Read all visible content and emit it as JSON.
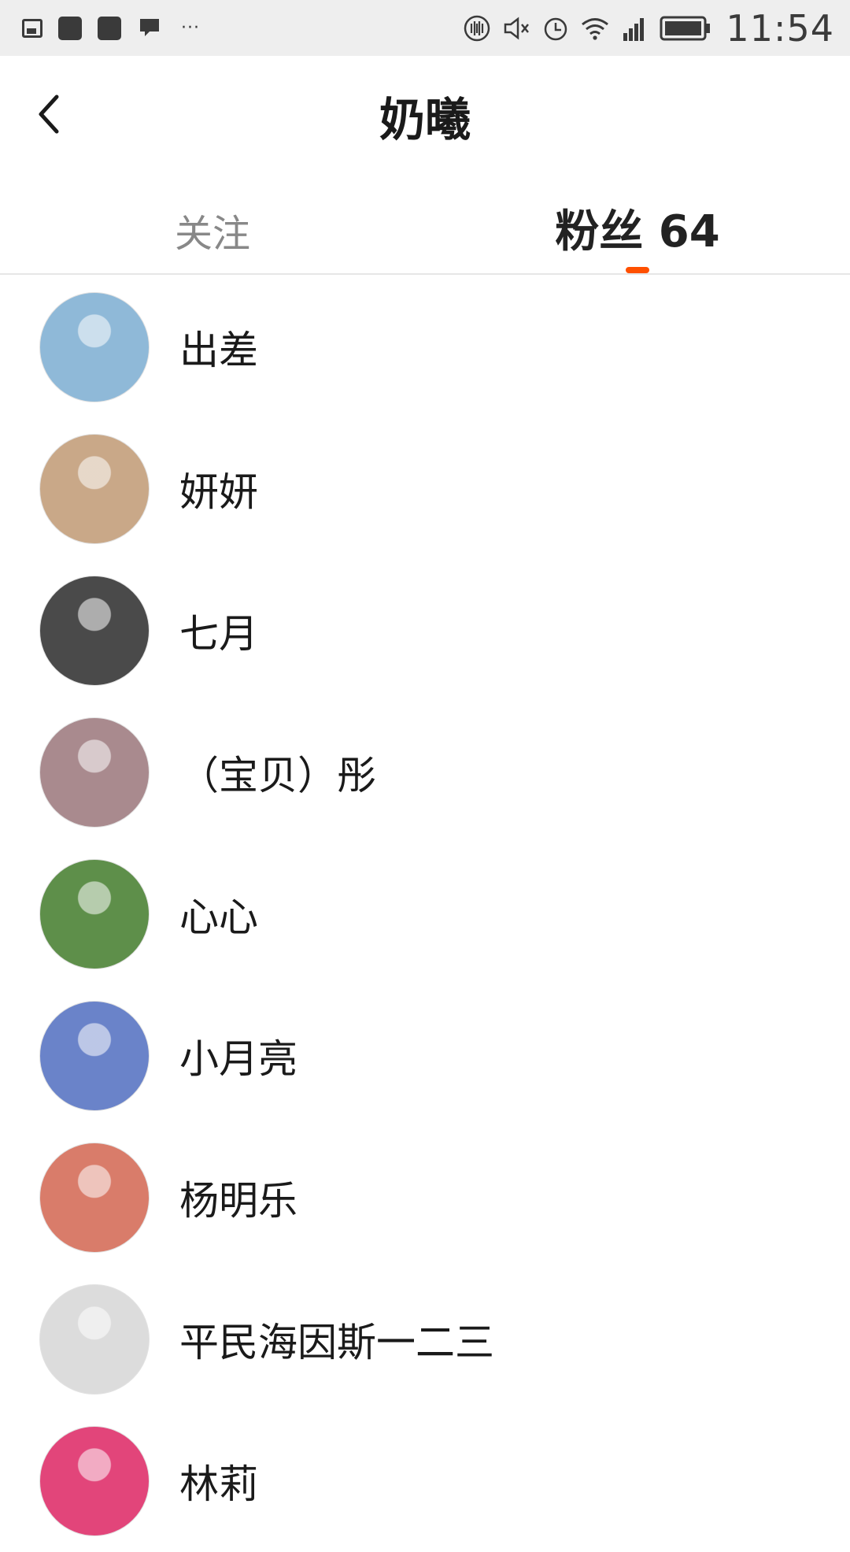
{
  "status_bar": {
    "time": "11:54",
    "dots": "···",
    "icons": [
      "image-icon",
      "app-icon",
      "app-icon",
      "chat-icon",
      "vibrate-icon",
      "mute-icon",
      "alarm-icon",
      "wifi-icon",
      "signal-icon",
      "battery-icon"
    ]
  },
  "navbar": {
    "title": "奶曦",
    "back_icon": "chevron-left-icon"
  },
  "tabs": {
    "following_label": "关注",
    "fans_label": "粉丝 64",
    "active": "fans",
    "accent": "#ff5000"
  },
  "fans": [
    {
      "name": "出差",
      "avatar_color": "#8fb9d8"
    },
    {
      "name": "妍妍",
      "avatar_color": "#c9a888"
    },
    {
      "name": "七月",
      "avatar_color": "#4a4a4a"
    },
    {
      "name": "（宝贝）彤",
      "avatar_color": "#a98a8e"
    },
    {
      "name": "心心",
      "avatar_color": "#5e8f4a"
    },
    {
      "name": "小月亮",
      "avatar_color": "#6a83c9"
    },
    {
      "name": "杨明乐",
      "avatar_color": "#d97c6a"
    },
    {
      "name": "平民海因斯一二三",
      "avatar_color": "#dcdcdc"
    },
    {
      "name": "林莉",
      "avatar_color": "#e2457a"
    }
  ]
}
